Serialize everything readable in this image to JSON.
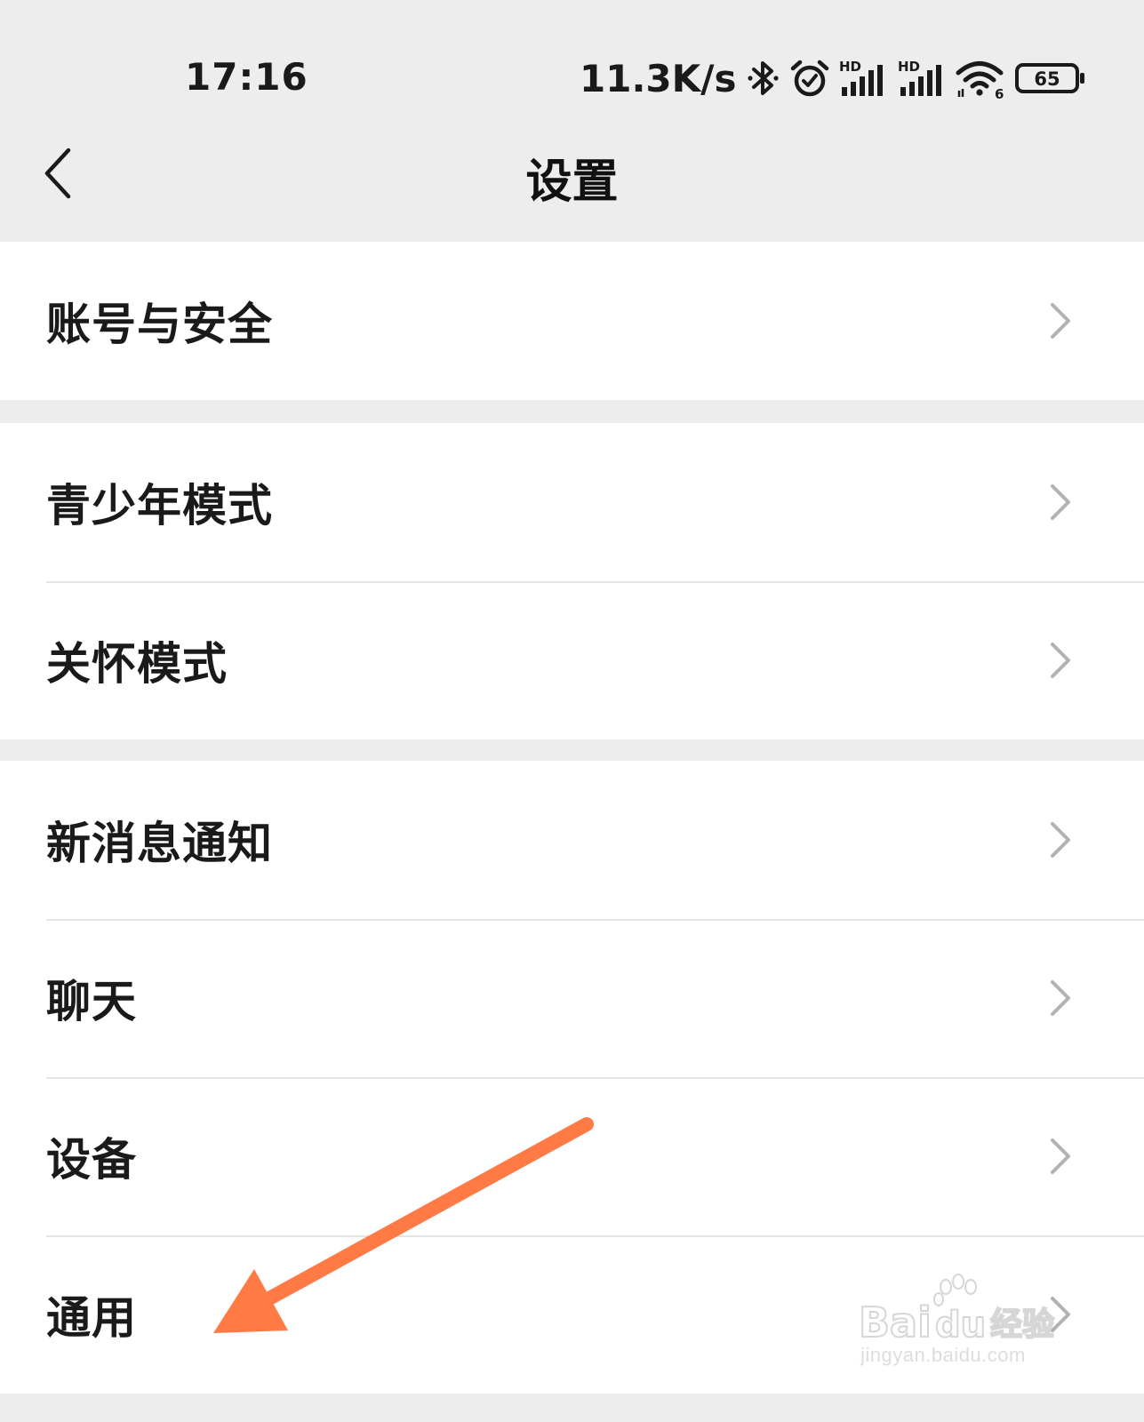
{
  "status_bar": {
    "time": "17:16",
    "net_speed": "11.3K/s",
    "battery": "65",
    "signal_label": "HD",
    "wifi_generation": "6",
    "icons": [
      "bluetooth-icon",
      "alarm-icon",
      "hd-signal-icon",
      "hd-signal-icon",
      "wifi-6-icon",
      "battery-icon"
    ]
  },
  "nav": {
    "title": "设置",
    "back_icon": "chevron-left-icon"
  },
  "groups": [
    {
      "items": [
        {
          "label": "账号与安全"
        }
      ]
    },
    {
      "items": [
        {
          "label": "青少年模式"
        },
        {
          "label": "关怀模式"
        }
      ]
    },
    {
      "items": [
        {
          "label": "新消息通知"
        },
        {
          "label": "聊天"
        },
        {
          "label": "设备"
        },
        {
          "label": "通用"
        }
      ]
    }
  ],
  "annotation": {
    "arrow_color": "#ff7a45",
    "points_to": "通用"
  },
  "watermark": {
    "logo_text": "Bai du 经验",
    "url": "jingyan.baidu.com"
  },
  "colors": {
    "page_bg": "#ededed",
    "cell_bg": "#ffffff",
    "divider": "#e4e4e4",
    "text": "#1a1a1a",
    "chevron": "#b2b2b2"
  }
}
